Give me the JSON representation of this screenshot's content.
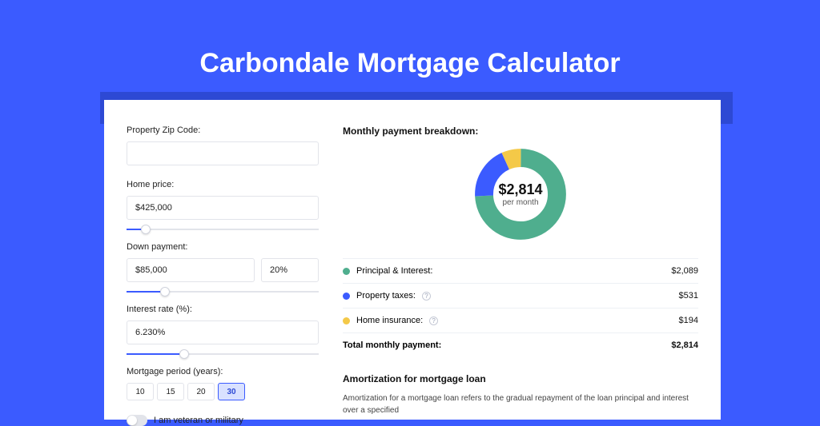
{
  "title": "Carbondale Mortgage Calculator",
  "left": {
    "zip_label": "Property Zip Code:",
    "zip_value": "",
    "home_price_label": "Home price:",
    "home_price_value": "$425,000",
    "down_payment_label": "Down payment:",
    "down_payment_value": "$85,000",
    "down_payment_pct": "20%",
    "interest_label": "Interest rate (%):",
    "interest_value": "6.230%",
    "period_label": "Mortgage period (years):",
    "periods": [
      "10",
      "15",
      "20",
      "30"
    ],
    "period_active": "30",
    "veteran_label": "I am veteran or military"
  },
  "right": {
    "breakdown_title": "Monthly payment breakdown:",
    "donut_amount": "$2,814",
    "donut_sub": "per month",
    "legend": {
      "pi_label": "Principal & Interest:",
      "pi_value": "$2,089",
      "tax_label": "Property taxes:",
      "tax_value": "$531",
      "ins_label": "Home insurance:",
      "ins_value": "$194",
      "total_label": "Total monthly payment:",
      "total_value": "$2,814"
    },
    "amort_title": "Amortization for mortgage loan",
    "amort_text": "Amortization for a mortgage loan refers to the gradual repayment of the loan principal and interest over a specified"
  },
  "chart_data": {
    "type": "pie",
    "title": "Monthly payment breakdown",
    "series": [
      {
        "name": "Principal & Interest",
        "value": 2089,
        "color": "#4fae8e"
      },
      {
        "name": "Property taxes",
        "value": 531,
        "color": "#3b5bff"
      },
      {
        "name": "Home insurance",
        "value": 194,
        "color": "#f4c948"
      }
    ],
    "total": 2814,
    "center_label": "$2,814 per month"
  }
}
